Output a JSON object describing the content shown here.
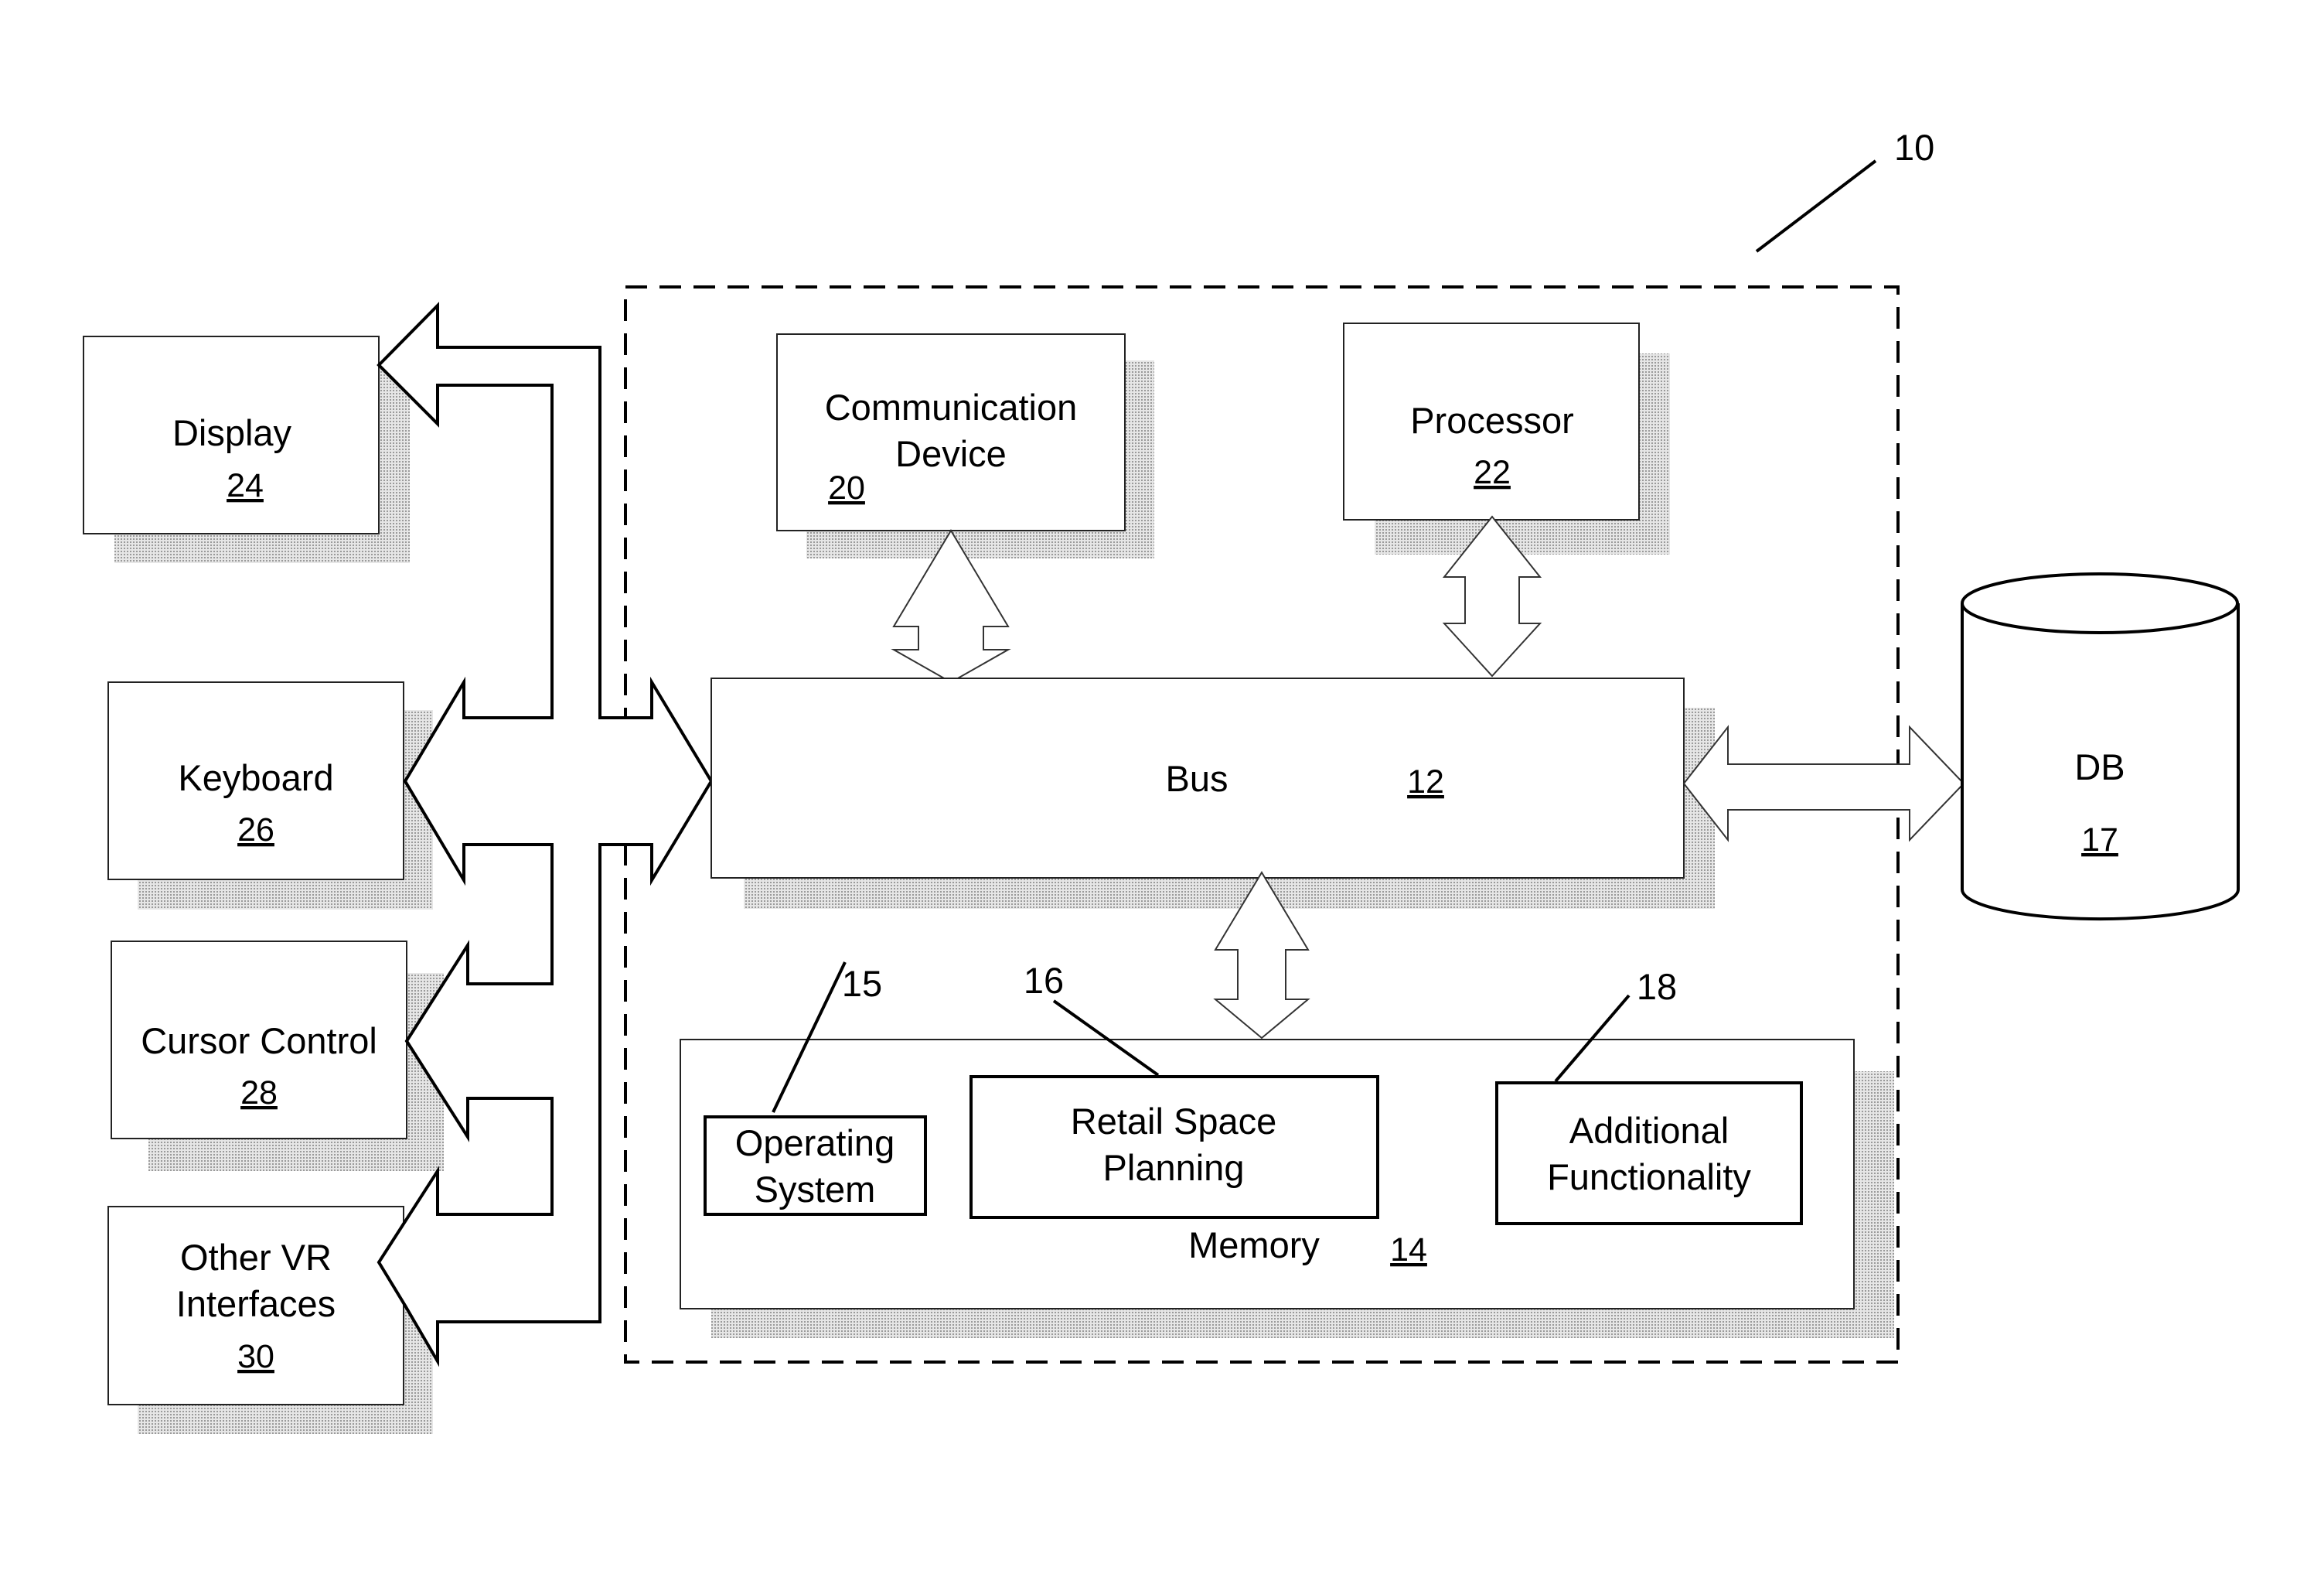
{
  "figure": {
    "reference": "10",
    "components": {
      "display": {
        "label": "Display",
        "number": "24"
      },
      "keyboard": {
        "label": "Keyboard",
        "number": "26"
      },
      "cursor_control": {
        "label": "Cursor Control",
        "number": "28"
      },
      "other_vr": {
        "label_line1": "Other VR",
        "label_line2": "Interfaces",
        "number": "30"
      },
      "communication_device": {
        "label_line1": "Communication",
        "label_line2": "Device",
        "number": "20"
      },
      "processor": {
        "label": "Processor",
        "number": "22"
      },
      "bus": {
        "label": "Bus",
        "number": "12"
      },
      "database": {
        "label": "DB",
        "number": "17"
      },
      "memory": {
        "label": "Memory",
        "number": "14"
      },
      "operating_system": {
        "label_line1": "Operating",
        "label_line2": "System",
        "reference": "15"
      },
      "retail_space_planning": {
        "label_line1": "Retail Space",
        "label_line2": "Planning",
        "reference": "16"
      },
      "additional_functionality": {
        "label_line1": "Additional",
        "label_line2": "Functionality",
        "reference": "18"
      }
    }
  }
}
